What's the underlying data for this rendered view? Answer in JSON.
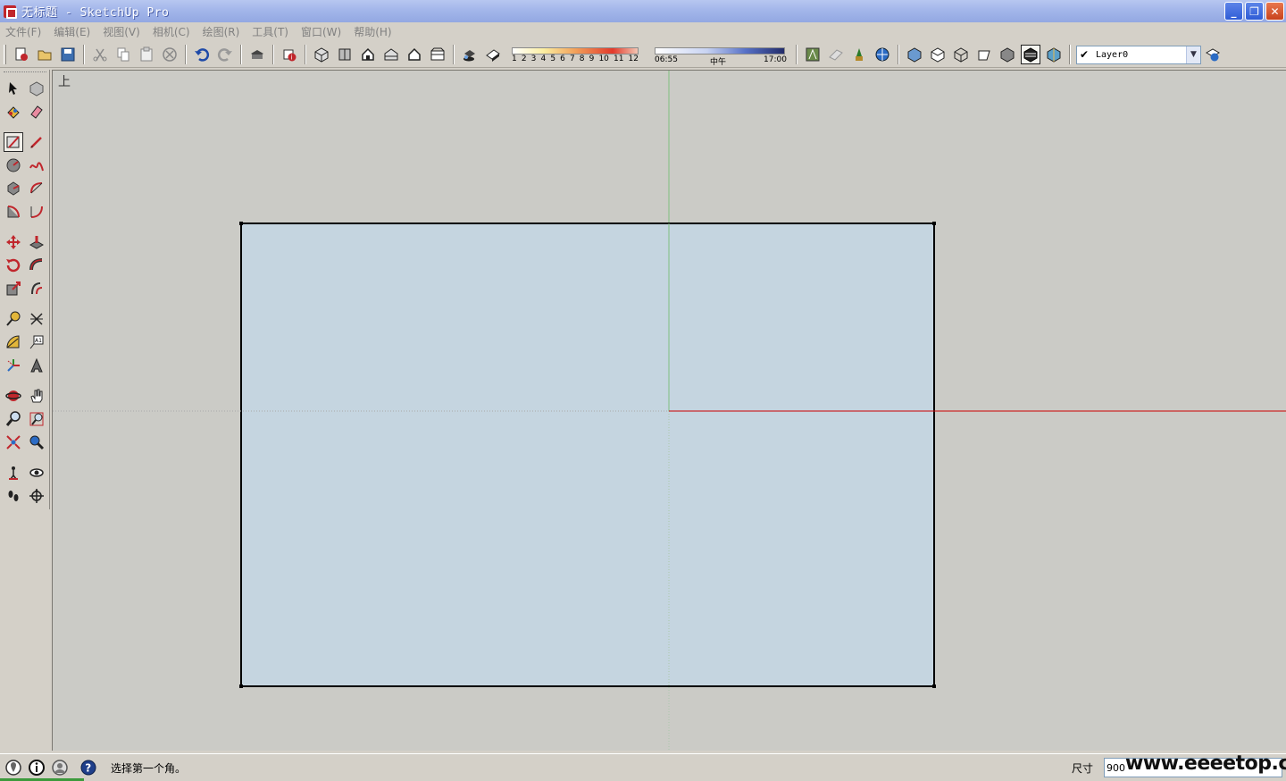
{
  "window": {
    "title": "无标题 - SketchUp Pro",
    "minimize_label": "_",
    "restore_label": "❐",
    "close_label": "✕"
  },
  "menu": [
    {
      "label": "文件(F)"
    },
    {
      "label": "编辑(E)"
    },
    {
      "label": "视图(V)"
    },
    {
      "label": "相机(C)"
    },
    {
      "label": "绘图(R)"
    },
    {
      "label": "工具(T)"
    },
    {
      "label": "窗口(W)"
    },
    {
      "label": "帮助(H)"
    }
  ],
  "shadow_settings": {
    "month_ticks": [
      "1",
      "2",
      "3",
      "4",
      "5",
      "6",
      "7",
      "8",
      "9",
      "10",
      "11",
      "12"
    ],
    "time_start": "06:55",
    "time_mid": "中午",
    "time_end": "17:00"
  },
  "layers": {
    "current": "Layer0",
    "checked": true
  },
  "viewport": {
    "view_name": "上",
    "colors": {
      "background": "#cbcbc6",
      "face": "#c5d5e0",
      "edge": "#000000",
      "green_axis": "#7fbf7f",
      "red_axis": "#cc0000"
    }
  },
  "status": {
    "prompt": "选择第一个角。",
    "vcb_label": "尺寸",
    "vcb_value": "900"
  },
  "watermark": "www.eeeetop.com",
  "icons": {
    "status": [
      "geo-location-icon",
      "credits-icon",
      "user-icon",
      "help-icon"
    ]
  }
}
